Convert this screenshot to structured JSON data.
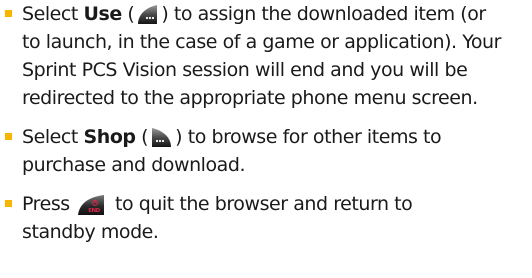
{
  "bullets": [
    {
      "lines": [
        {
          "pre": "Select ",
          "bold": "Use",
          "post_icon_prefix": " (",
          "post_icon_suffix": ") to assign the downloaded item (or"
        },
        {
          "text": "to launch, in the case of a game or application). Your"
        },
        {
          "text": "Sprint PCS Vision session will end and you will be"
        },
        {
          "text": "redirected to the appropriate phone menu screen."
        }
      ],
      "icon": "left-softkey-icon"
    },
    {
      "lines": [
        {
          "pre": "Select ",
          "bold": "Shop",
          "post_icon_prefix": " (",
          "post_icon_suffix": ") to browse for other items to"
        },
        {
          "text": "purchase and download."
        }
      ],
      "icon": "right-softkey-icon"
    },
    {
      "lines": [
        {
          "pre": "Press ",
          "post": " to quit the browser and return to"
        },
        {
          "text": "standby mode."
        }
      ],
      "icon": "end-key-icon"
    }
  ],
  "colors": {
    "bullet": "#f7b500",
    "text": "#1a1a1a",
    "end_key": "#c0132b"
  },
  "icon_labels": {
    "end": "END"
  }
}
